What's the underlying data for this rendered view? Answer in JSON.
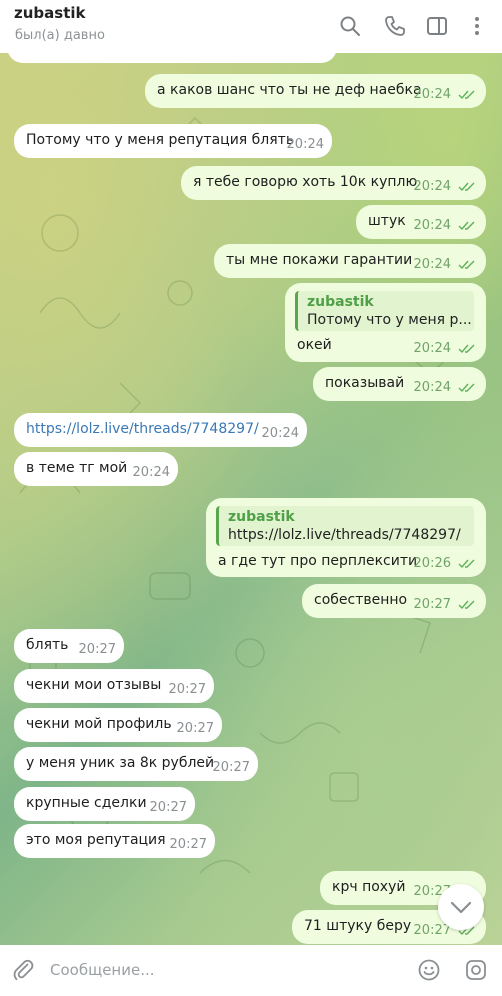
{
  "header": {
    "title": "zubastik",
    "status": "был(а) давно"
  },
  "messages": [
    {
      "dir": "out",
      "text": "а каков шанс что ты не деф наебка",
      "time": "20:24"
    },
    {
      "dir": "in",
      "text": "Потому что у меня репутация блять",
      "time": "20:24"
    },
    {
      "dir": "out",
      "text": "я тебе говорю хоть 10к куплю",
      "time": "20:24"
    },
    {
      "dir": "out",
      "text": "штук",
      "time": "20:24"
    },
    {
      "dir": "out",
      "text": "ты мне покажи гарантии",
      "time": "20:24"
    },
    {
      "dir": "out",
      "reply_name": "zubastik",
      "reply_text": "Потому что у меня р...",
      "text": "окей",
      "time": "20:24"
    },
    {
      "dir": "out",
      "text": "показывай",
      "time": "20:24"
    },
    {
      "dir": "in",
      "text": "https://lolz.live/threads/7748297/",
      "time": "20:24"
    },
    {
      "dir": "in",
      "text": "в теме тг мой",
      "time": "20:24"
    },
    {
      "dir": "out",
      "reply_name": "zubastik",
      "reply_text": "https://lolz.live/threads/7748297/",
      "text": "а где тут про перплексити",
      "time": "20:26"
    },
    {
      "dir": "out",
      "text": "собественно",
      "time": "20:27"
    },
    {
      "dir": "in",
      "text": "блять",
      "time": "20:27"
    },
    {
      "dir": "in",
      "text": "чекни мои отзывы",
      "time": "20:27"
    },
    {
      "dir": "in",
      "text": "чекни мой профиль",
      "time": "20:27"
    },
    {
      "dir": "in",
      "text": "у меня уник за 8к рублей",
      "time": "20:27"
    },
    {
      "dir": "in",
      "text": "крупные сделки",
      "time": "20:27"
    },
    {
      "dir": "in",
      "text": "это моя репутация",
      "time": "20:27"
    },
    {
      "dir": "out",
      "text": "крч похуй",
      "time": "20:27"
    },
    {
      "dir": "out",
      "text": "71 штуку беру",
      "time": "20:27"
    }
  ],
  "composer": {
    "placeholder": "Сообщение..."
  },
  "icons": [
    "search-icon",
    "phone-icon",
    "sidebar-icon",
    "more-icon",
    "attach-icon",
    "emoji-icon",
    "camera-icon",
    "chevron-down-icon",
    "double-check-icon"
  ],
  "colors": {
    "incoming": "#ffffff",
    "outgoing": "#effdde",
    "link": "#3a78b6",
    "accent": "#4fa048"
  }
}
